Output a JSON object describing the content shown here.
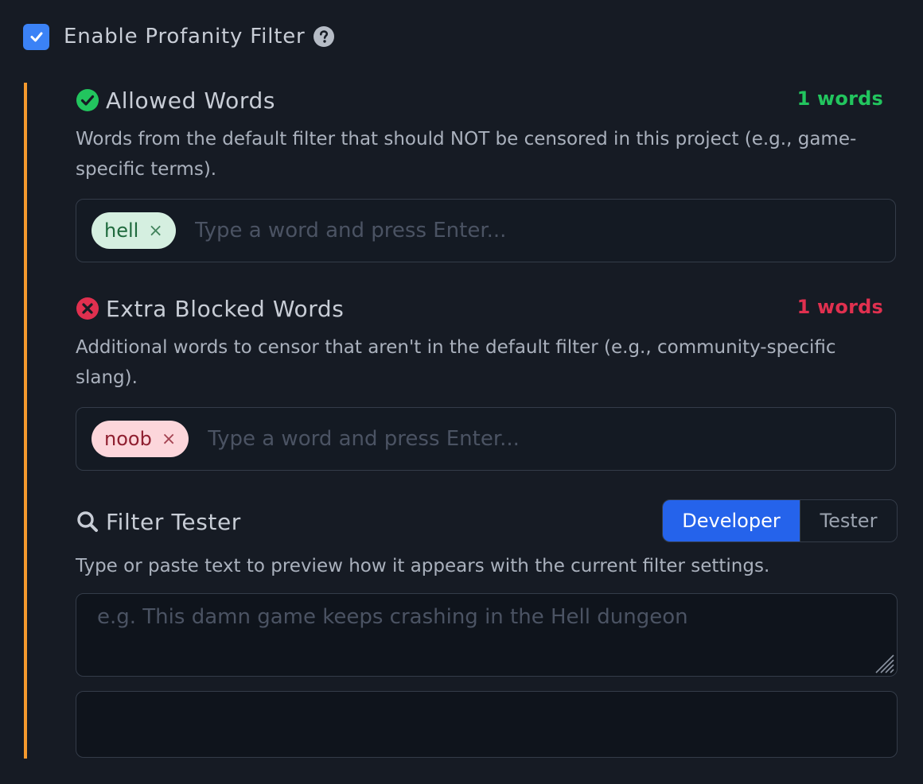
{
  "enable_filter": {
    "label": "Enable Profanity Filter",
    "checked": true,
    "icon": "help-circle-icon"
  },
  "allowed": {
    "title": "Allowed Words",
    "icon": "check-circle-icon",
    "count": "1 words",
    "description": "Words from the default filter that should NOT be censored in this project (e.g., game-specific terms).",
    "tags": [
      "hell"
    ],
    "remove_symbol": "×",
    "placeholder": "Type a word and press Enter...",
    "color": "#22c55e"
  },
  "blocked": {
    "title": "Extra Blocked Words",
    "icon": "x-circle-icon",
    "count": "1 words",
    "description": "Additional words to censor that aren't in the default filter (e.g., community-specific slang).",
    "tags": [
      "noob"
    ],
    "remove_symbol": "×",
    "placeholder": "Type a word and press Enter...",
    "color": "#e0304f"
  },
  "tester": {
    "title": "Filter Tester",
    "icon": "search-icon",
    "modes": [
      "Developer",
      "Tester"
    ],
    "active_mode": "Developer",
    "description": "Type or paste text to preview how it appears with the current filter settings.",
    "placeholder": "e.g. This damn game keeps crashing in the Hell dungeon",
    "output": ""
  },
  "colors": {
    "accent_bar": "#f59a2e",
    "primary": "#2563eb",
    "background": "#161b24"
  }
}
